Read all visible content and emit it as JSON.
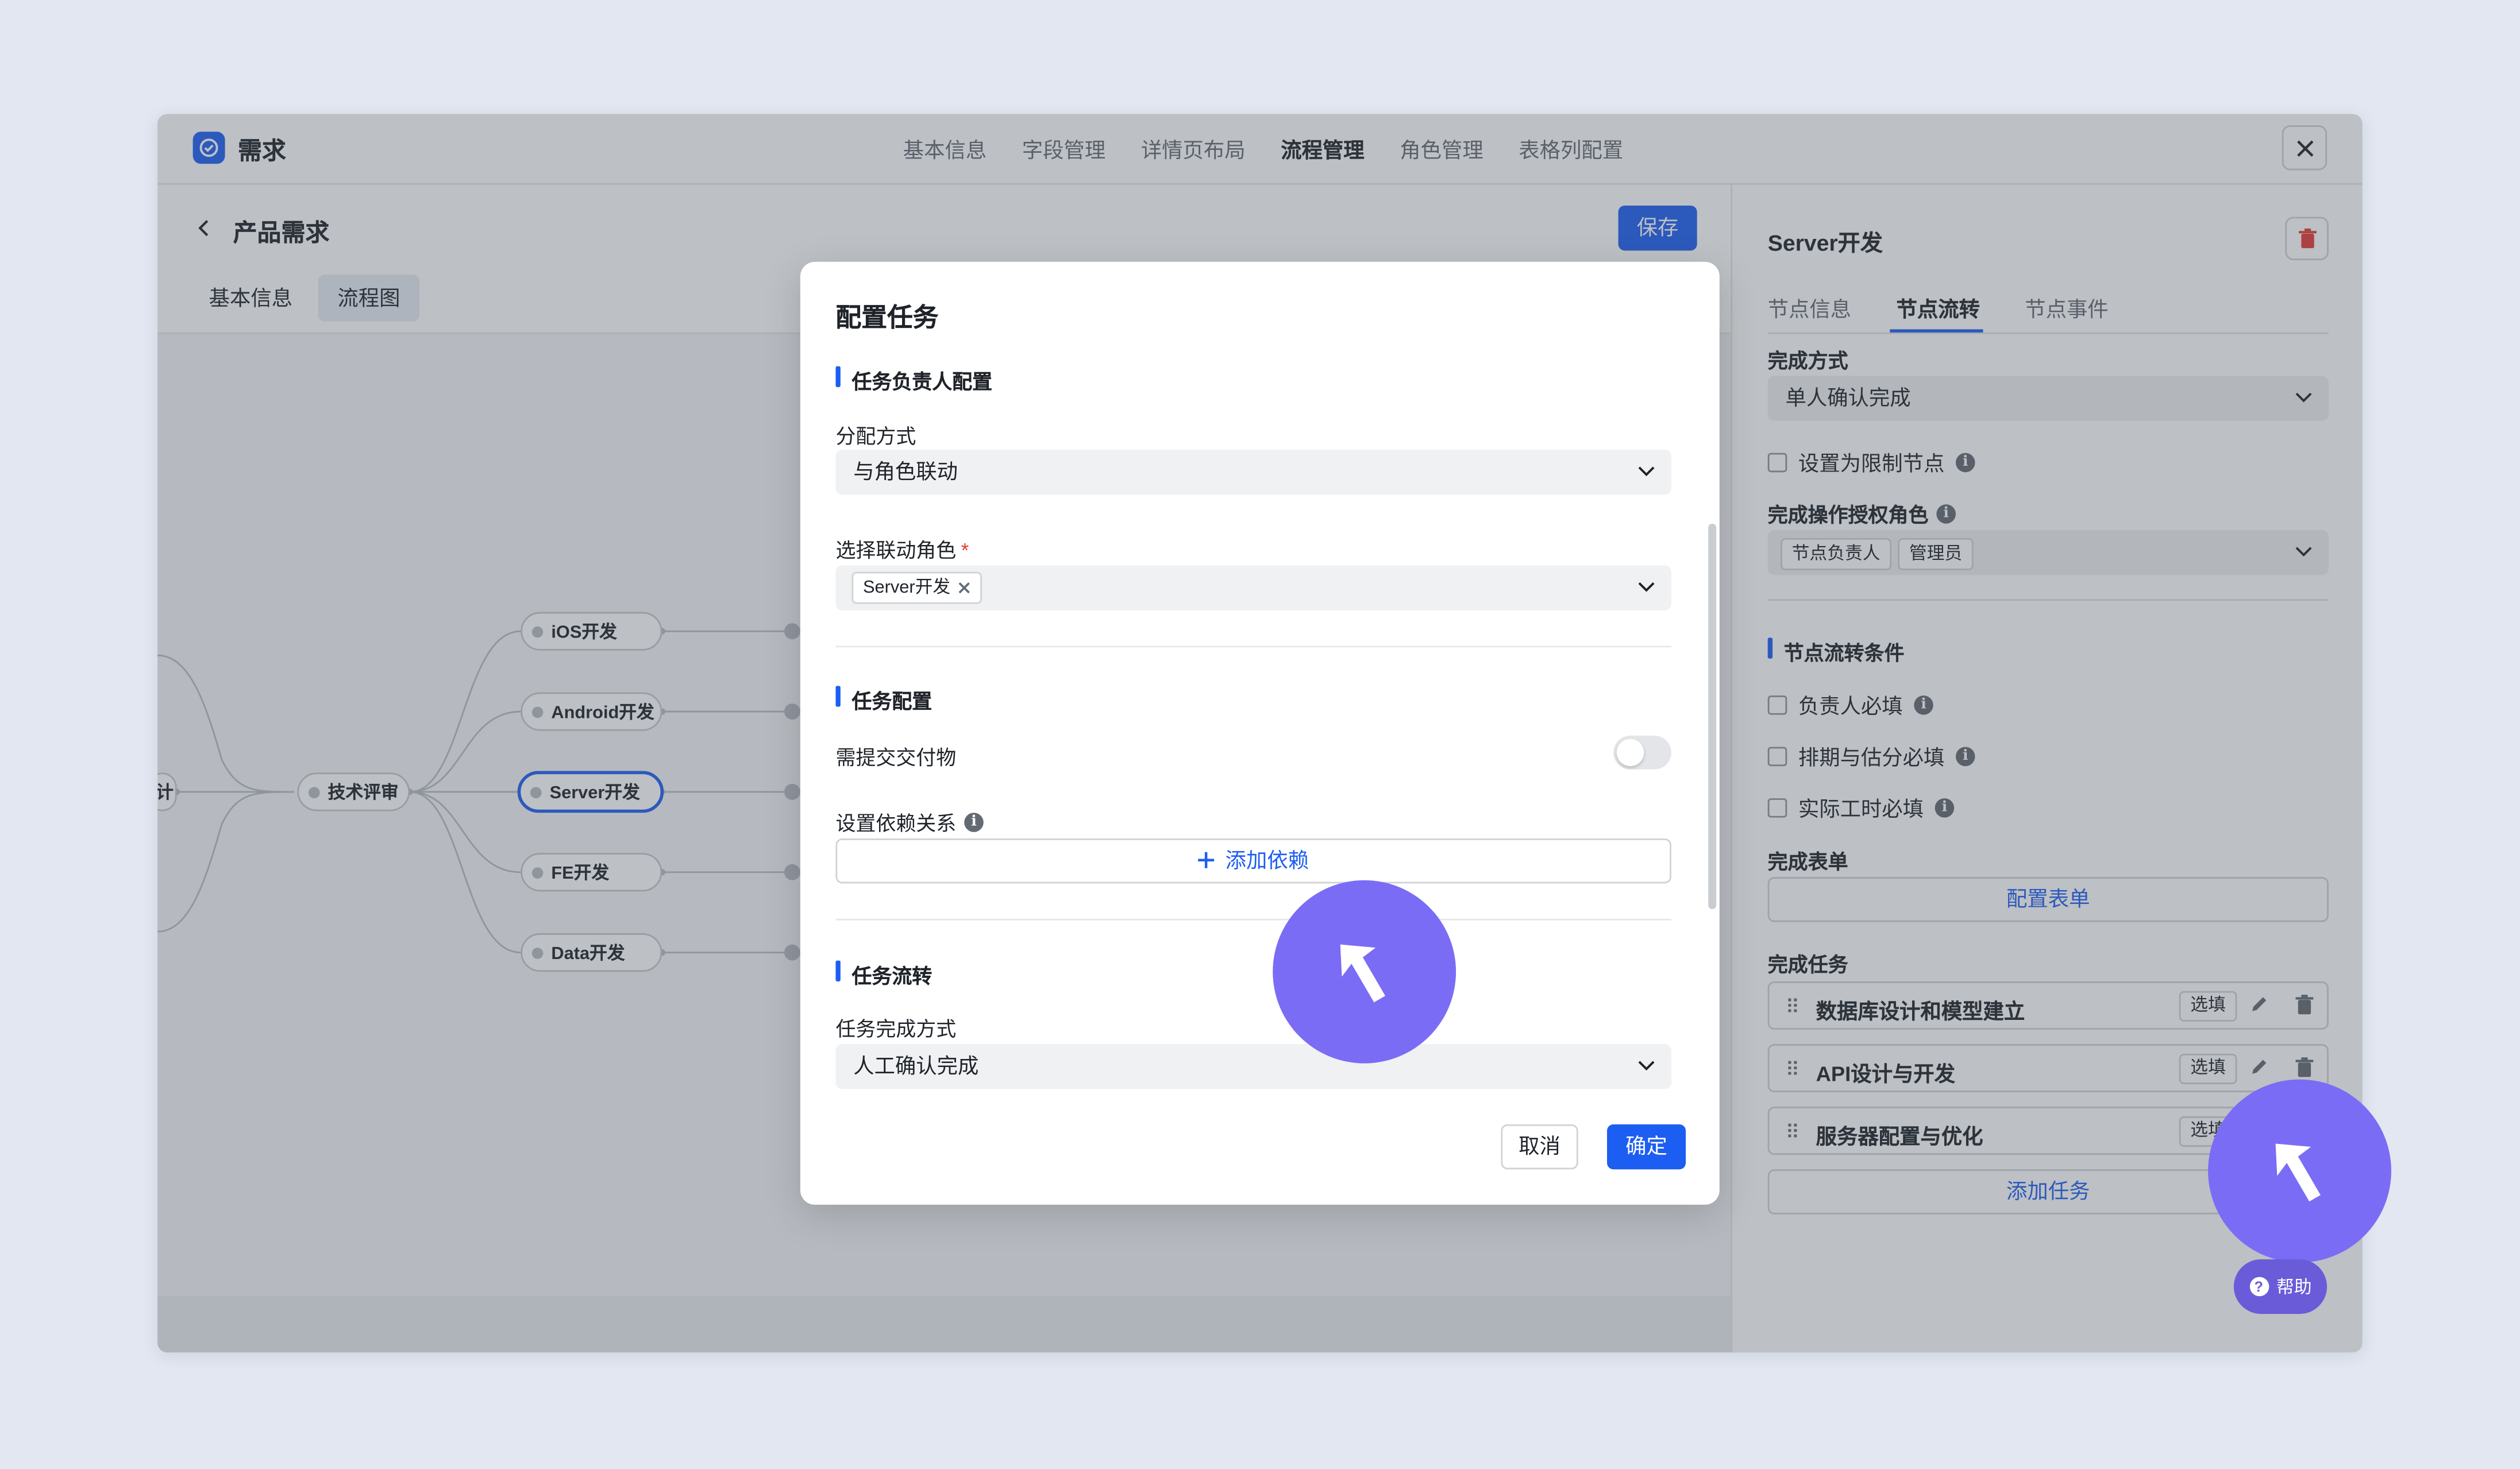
{
  "app": {
    "title": "需求",
    "nav_tabs": [
      "基本信息",
      "字段管理",
      "详情页布局",
      "流程管理",
      "角色管理",
      "表格列配置"
    ],
    "active_tab_index": 3
  },
  "left": {
    "title": "产品需求",
    "save_label": "保存",
    "sub_tabs": [
      "基本信息",
      "流程图"
    ],
    "edge_fragment": "计",
    "nodes": {
      "review": "技术评审",
      "ios": "iOS开发",
      "android": "Android开发",
      "server": "Server开发",
      "fe": "FE开发",
      "data": "Data开发"
    }
  },
  "right": {
    "title": "Server开发",
    "tabs": [
      "节点信息",
      "节点流转",
      "节点事件"
    ],
    "active_tab_index": 1,
    "completion_method_label": "完成方式",
    "completion_method_value": "单人确认完成",
    "restrict_node_label": "设置为限制节点",
    "auth_roles_label": "完成操作授权角色",
    "auth_roles": [
      "节点负责人",
      "管理员"
    ],
    "flow_conditions_title": "节点流转条件",
    "conditions": [
      "负责人必填",
      "排期与估分必填",
      "实际工时必填"
    ],
    "form_label": "完成表单",
    "form_button": "配置表单",
    "tasks_label": "完成任务",
    "tasks": [
      {
        "name": "数据库设计和模型建立",
        "tag": "选填"
      },
      {
        "name": "API设计与开发",
        "tag": "选填"
      },
      {
        "name": "服务器配置与优化",
        "tag": "选填"
      }
    ],
    "add_task_button": "添加任务",
    "help_label": "帮助"
  },
  "modal": {
    "title": "配置任务",
    "section_assignee": "任务负责人配置",
    "assign_method_label": "分配方式",
    "assign_method_value": "与角色联动",
    "linked_role_label": "选择联动角色",
    "required_mark": "*",
    "linked_role_chip": "Server开发",
    "section_task": "任务配置",
    "deliverable_label": "需提交交付物",
    "deliverable_enabled": false,
    "dependency_label": "设置依赖关系",
    "add_dependency": "添加依赖",
    "section_flow": "任务流转",
    "completion_label": "任务完成方式",
    "completion_value": "人工确认完成",
    "cancel_label": "取消",
    "ok_label": "确定"
  },
  "colors": {
    "accent": "#1d5ef2",
    "cursor": "#7b6cf5",
    "danger": "#e53935"
  }
}
